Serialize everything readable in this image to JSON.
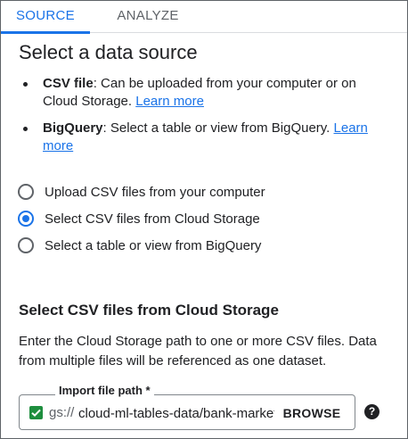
{
  "tabs": {
    "source": "SOURCE",
    "analyze": "ANALYZE"
  },
  "title": "Select a data source",
  "bullets": [
    {
      "term": "CSV file",
      "text": ": Can be uploaded from your computer or on Cloud Storage. ",
      "link": "Learn more"
    },
    {
      "term": "BigQuery",
      "text": ": Select a table or view from BigQuery. ",
      "link": "Learn more"
    }
  ],
  "radios": [
    {
      "label": "Upload CSV files from your computer",
      "selected": false
    },
    {
      "label": "Select CSV files from Cloud Storage",
      "selected": true
    },
    {
      "label": "Select a table or view from BigQuery",
      "selected": false
    }
  ],
  "section": {
    "title": "Select CSV files from Cloud Storage",
    "description": "Enter the Cloud Storage path to one or more CSV files. Data from multiple files will be referenced as one dataset."
  },
  "import_field": {
    "label": "Import file path *",
    "prefix": "gs://",
    "value": "cloud-ml-tables-data/bank-marketing.csv",
    "browse_label": "BROWSE",
    "help_glyph": "?"
  },
  "colors": {
    "accent": "#1a73e8",
    "valid": "#1e8e3e"
  }
}
